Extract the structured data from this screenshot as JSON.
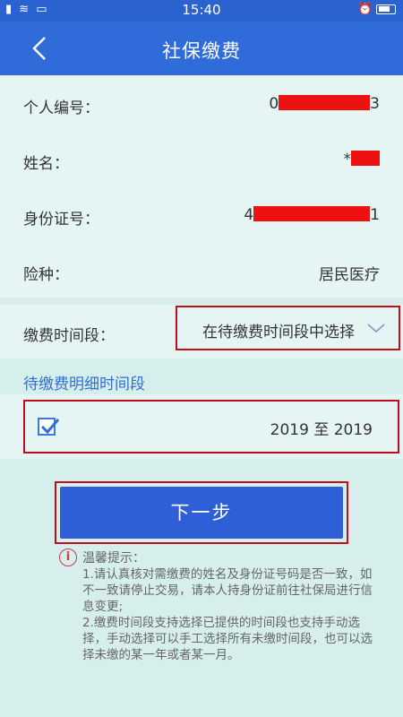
{
  "status_bar": {
    "left_icons": "▮ ≋ ▭",
    "time": "15:40",
    "right_icons": "⏰"
  },
  "header": {
    "title": "社保缴费"
  },
  "info": {
    "person_id": {
      "label": "个人编号：",
      "prefix": "0",
      "suffix": "3"
    },
    "name": {
      "label": "姓名：",
      "prefix": "*",
      "suffix": ""
    },
    "id_number": {
      "label": "身份证号：",
      "prefix": "4",
      "suffix": "1"
    },
    "insurance": {
      "label": "险种：",
      "value": "居民医疗"
    }
  },
  "period": {
    "label": "缴费时间段：",
    "placeholder": "在待缴费时间段中选择"
  },
  "detail": {
    "section_title": "待缴费明细时间段",
    "range_text": "2019 至 2019",
    "checked": true
  },
  "next_button": {
    "label": "下一步"
  },
  "tips": {
    "title": "温馨提示：",
    "body": "1.请认真核对需缴费的姓名及身份证号码是否一致，如不一致请停止交易，请本人持身份证前往社保局进行信息变更;\n2.缴费时间段支持选择已提供的时间段也支持手动选择，手动选择可以手工选择所有未缴时间段，也可以选择未缴的某一年或者某一月。"
  },
  "colors": {
    "nav": "#2f6bd9",
    "accent_red": "#c00e1a",
    "button": "#2f5fd7",
    "background": "#d6efec"
  }
}
